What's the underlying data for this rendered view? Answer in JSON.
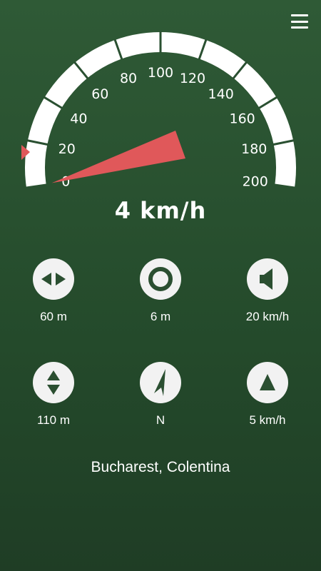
{
  "speedometer": {
    "current_speed": 4,
    "max_speed": 200,
    "speed_display": "4 km/h",
    "tick_labels": [
      "0",
      "20",
      "40",
      "60",
      "80",
      "100",
      "120",
      "140",
      "160",
      "180",
      "200"
    ],
    "needle_color": "#e0585a",
    "arc_color": "#ffffff",
    "marker_color": "#e0585a"
  },
  "stats": [
    {
      "icon": "horizontal-arrows-icon",
      "value": "60 m"
    },
    {
      "icon": "target-circle-icon",
      "value": "6 m"
    },
    {
      "icon": "speaker-icon",
      "value": "20 km/h"
    },
    {
      "icon": "vertical-arrows-icon",
      "value": "110 m"
    },
    {
      "icon": "compass-icon",
      "value": "N"
    },
    {
      "icon": "triangle-up-icon",
      "value": "5 km/h"
    }
  ],
  "location": "Bucharest, Colentina",
  "menu": {
    "icon": "hamburger-menu-icon"
  }
}
